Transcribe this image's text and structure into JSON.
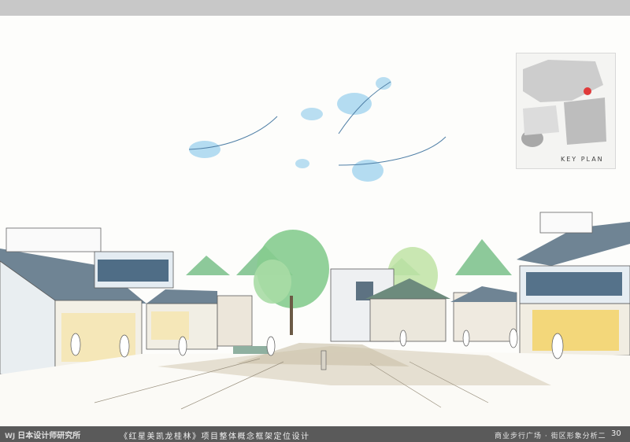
{
  "header": {},
  "drawing": {
    "subject": "street-view-perspective-sketch",
    "keyplan_label": "KEY PLAN"
  },
  "footer": {
    "logo_mark": "WJ",
    "logo_text": "日本设计师研究所",
    "title": "《红星美凯龙桂林》项目整体概念框架定位设计",
    "subtitle": "商业步行广场 · 街区形象分析二",
    "page_number": "30"
  },
  "colors": {
    "band": "#c8c8c8",
    "footer": "#5a5a5a",
    "sky_wash": "#9fd0ea",
    "tree": "#7cc28a",
    "hill": "#86c493",
    "roof": "#5d7282"
  }
}
